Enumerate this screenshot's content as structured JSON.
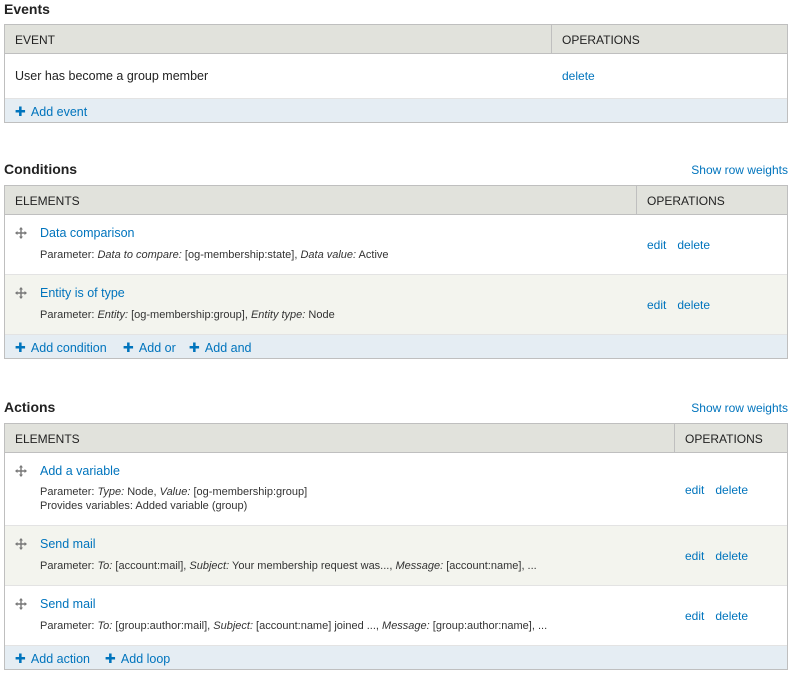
{
  "events": {
    "title": "Events",
    "columns": [
      "EVENT",
      "OPERATIONS"
    ],
    "rows": [
      {
        "label": "User has become a group member",
        "ops": [
          "delete"
        ]
      }
    ],
    "footer_links": [
      "Add event"
    ]
  },
  "conditions": {
    "title": "Conditions",
    "row_weights": "Show row weights",
    "columns": [
      "ELEMENTS",
      "OPERATIONS"
    ],
    "rows": [
      {
        "label": "Data comparison",
        "param_prefix": "Parameter: ",
        "p1_key": "Data to compare:",
        "p1_val": " [og-membership:state], ",
        "p2_key": "Data value:",
        "p2_val": " Active",
        "ops": [
          "edit",
          "delete"
        ]
      },
      {
        "label": "Entity is of type",
        "param_prefix": "Parameter: ",
        "p1_key": "Entity:",
        "p1_val": " [og-membership:group], ",
        "p2_key": "Entity type:",
        "p2_val": " Node",
        "ops": [
          "edit",
          "delete"
        ]
      }
    ],
    "footer_links": [
      "Add condition",
      "Add or",
      "Add and"
    ]
  },
  "actions": {
    "title": "Actions",
    "row_weights": "Show row weights",
    "columns": [
      "ELEMENTS",
      "OPERATIONS"
    ],
    "rows": [
      {
        "label": "Add a variable",
        "param_prefix": "Parameter: ",
        "p1_key": "Type:",
        "p1_val": " Node, ",
        "p2_key": "Value:",
        "p2_val": " [og-membership:group]",
        "extra": "Provides variables: Added variable (group)",
        "ops": [
          "edit",
          "delete"
        ]
      },
      {
        "label": "Send mail",
        "param_prefix": "Parameter: ",
        "p1_key": "To:",
        "p1_val": " [account:mail], ",
        "p2_key": "Subject:",
        "p2_val": " Your membership request was..., ",
        "p3_key": "Message:",
        "p3_val": " [account:name], ...",
        "ops": [
          "edit",
          "delete"
        ]
      },
      {
        "label": "Send mail",
        "param_prefix": "Parameter: ",
        "p1_key": "To:",
        "p1_val": " [group:author:mail], ",
        "p2_key": "Subject:",
        "p2_val": " [account:name] joined ..., ",
        "p3_key": "Message:",
        "p3_val": " [group:author:name], ...",
        "ops": [
          "edit",
          "delete"
        ]
      }
    ],
    "footer_links": [
      "Add action",
      "Add loop"
    ]
  },
  "colors": {
    "link": "#0074bd",
    "header_bg": "#e1e2dc",
    "footer_bg": "#e5edf3",
    "row_alt": "#f3f4ee"
  },
  "icons": {
    "drag": "drag-handle-icon",
    "add": "plus-icon"
  }
}
